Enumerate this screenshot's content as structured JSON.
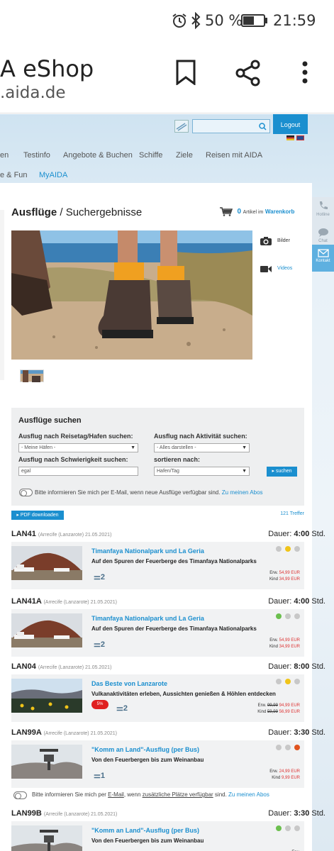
{
  "status": {
    "battery": "50 %",
    "time": "21:59"
  },
  "browser": {
    "title": "A eShop",
    "url": ".aida.de"
  },
  "header": {
    "logout": "Logout",
    "nav_row1": [
      "en",
      "Testinfo",
      "Angebote & Buchen",
      "Schiffe",
      "Ziele",
      "Reisen mit AIDA"
    ],
    "nav_row2": [
      "e & Fun",
      "MyAIDA"
    ]
  },
  "breadcrumb": {
    "section": "Ausflüge",
    "sep": " / ",
    "page": "Suchergebnisse"
  },
  "cart": {
    "count": "0",
    "text": "Artikel im",
    "link": "Warenkorb"
  },
  "media": {
    "photos": "Bilder",
    "videos": "Videos"
  },
  "sidebar": {
    "phone": "Hotline",
    "chat": "Chat",
    "contact": "Kontakt"
  },
  "search": {
    "title": "Ausflüge suchen",
    "port_label": "Ausflug nach Reisetag/Hafen suchen:",
    "port_value": "- Meine Häfen -",
    "activity_label": "Ausflug nach Aktivität suchen:",
    "activity_value": "- Alles darstellen -",
    "difficulty_label": "Ausflug nach Schwierigkeit suchen:",
    "difficulty_value": "egal",
    "sort_label": "sortieren nach:",
    "sort_value": "Hafen/Tag",
    "submit": "suchen",
    "notify_text": "Bitte informieren Sie mich per E-Mail, wenn neue Ausflüge verfügbar sind.",
    "notify_link": "Zu meinen Abos"
  },
  "results": {
    "pdf": "PDF downloaden",
    "count": "121 Treffer"
  },
  "duration_label": "Dauer:",
  "duration_unit": "Std.",
  "items": [
    {
      "code": "LAN41",
      "port": "(Arrecife (Lanzarote) 21.05.2021)",
      "duration": "4:00",
      "title": "Timanfaya Nationalpark und La Geria",
      "subtitle": "Auf den Spuren der Feuerberge des Timanfaya Nationalparks",
      "persons": "2",
      "adult_label": "Erw.",
      "adult_old": "",
      "adult_price": "54,99 EUR",
      "child_label": "Kind",
      "child_old": "",
      "child_price": "34,99 EUR",
      "badge": "",
      "lights": [
        "#c8c8c8",
        "#f0c419",
        "#c8c8c8"
      ]
    },
    {
      "code": "LAN41A",
      "port": "(Arrecife (Lanzarote) 21.05.2021)",
      "duration": "4:00",
      "title": "Timanfaya Nationalpark und La Geria",
      "subtitle": "Auf den Spuren der Feuerberge des Timanfaya Nationalparks",
      "persons": "2",
      "adult_label": "Erw.",
      "adult_old": "",
      "adult_price": "54,99 EUR",
      "child_label": "Kind",
      "child_old": "",
      "child_price": "34,99 EUR",
      "badge": "",
      "lights": [
        "#6bbf4e",
        "#c8c8c8",
        "#c8c8c8"
      ]
    },
    {
      "code": "LAN04",
      "port": "(Arrecife (Lanzarote) 21.05.2021)",
      "duration": "8:00",
      "title": "Das Beste von Lanzarote",
      "subtitle": "Vulkanaktivitäten erleben, Aussichten genießen & Höhlen entdecken",
      "persons": "2",
      "adult_label": "Erw.",
      "adult_old": "99,99",
      "adult_price": "94,99 EUR",
      "child_label": "Kind",
      "child_old": "59,99",
      "child_price": "56,99 EUR",
      "badge": "5%",
      "lights": [
        "#c8c8c8",
        "#f0c419",
        "#c8c8c8"
      ]
    },
    {
      "code": "LAN99A",
      "port": "(Arrecife (Lanzarote) 21.05.2021)",
      "duration": "3:30",
      "title": "\"Komm an Land\"-Ausflug (per Bus)",
      "subtitle": "Von den Feuerbergen bis zum Weinanbau",
      "persons": "1",
      "adult_label": "Erw.",
      "adult_old": "",
      "adult_price": "24,99 EUR",
      "child_label": "Kind",
      "child_old": "",
      "child_price": "9,99 EUR",
      "badge": "",
      "lights": [
        "#c8c8c8",
        "#c8c8c8",
        "#e0531e"
      ]
    },
    {
      "code": "LAN99B",
      "port": "(Arrecife (Lanzarote) 21.05.2021)",
      "duration": "3:30",
      "title": "\"Komm an Land\"-Ausflug (per Bus)",
      "subtitle": "Von den Feuerbergen bis zum Weinanbau",
      "persons": "",
      "adult_label": "Erw.",
      "adult_old": "",
      "adult_price": "",
      "child_label": "",
      "child_old": "",
      "child_price": "",
      "badge": "",
      "lights": [
        "#6bbf4e",
        "#c8c8c8",
        "#c8c8c8"
      ]
    }
  ],
  "notify2": {
    "text1": "Bitte informieren Sie mich per ",
    "email": "E-Mail",
    "text2": ", wenn ",
    "extra": "zusätzliche Plätze verfügbar",
    "text3": " sind.",
    "link": "Zu meinen Abos"
  }
}
